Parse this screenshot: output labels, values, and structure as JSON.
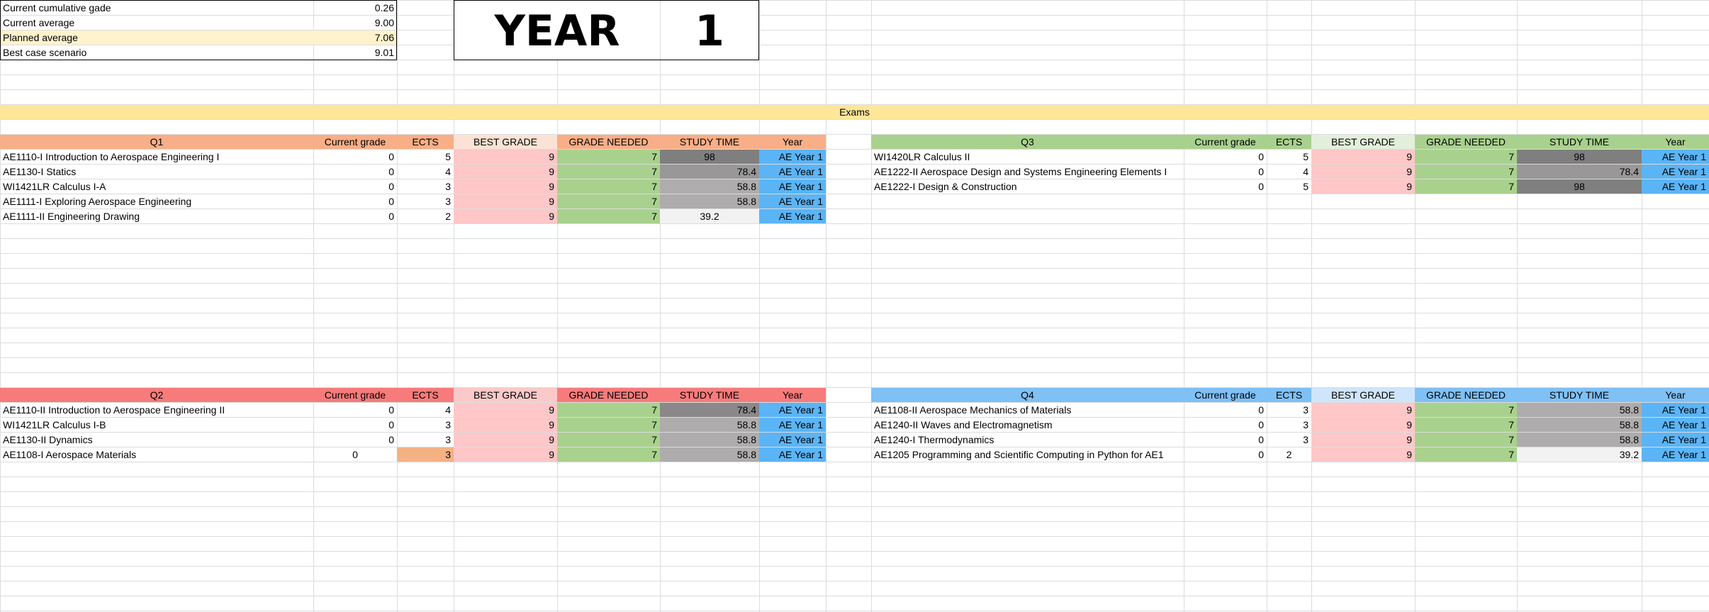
{
  "summary": [
    {
      "label": "Current cumulative gade",
      "value": "0.26",
      "highlight": false
    },
    {
      "label": "Current average",
      "value": "9.00",
      "highlight": false
    },
    {
      "label": "Planned average",
      "value": "7.06",
      "highlight": true
    },
    {
      "label": "Best case scenario",
      "value": "9.01",
      "highlight": false
    }
  ],
  "year_box": {
    "word": "YEAR",
    "number": "1"
  },
  "exams_banner": "Exams",
  "headers": {
    "current_grade": "Current grade",
    "ects": "ECTS",
    "best_grade": "BEST GRADE",
    "grade_needed": "GRADE NEEDED",
    "study_time": "STUDY TIME",
    "year": "Year"
  },
  "colors": {
    "q1": "#f8ae86",
    "q1_light": "#fce2d4",
    "q2": "#f77b7b",
    "q2_light": "#fcc9c9",
    "q3": "#a9d18e",
    "q3_light": "#e2efda",
    "q4": "#7fc0f5",
    "q4_light": "#cfe5fb",
    "best": "#ffc7c7",
    "needed": "#a9d18e",
    "year": "#5bb4f5",
    "banner": "#ffe699",
    "highlight": "#fff2cc"
  },
  "quarters": [
    {
      "id": "q1",
      "name": "Q1",
      "courses": [
        {
          "course": "AE1110-I Introduction to Aerospace Engineering I",
          "current": "0",
          "ects": "5",
          "best": "9",
          "needed": "7",
          "study": "98",
          "year": "AE Year 1",
          "study_shade": "#7f7f7f"
        },
        {
          "course": "AE1130-I Statics",
          "current": "0",
          "ects": "4",
          "best": "9",
          "needed": "7",
          "study": "78.4",
          "year": "AE Year 1",
          "study_shade": "#999797"
        },
        {
          "course": "WI1421LR Calculus I-A",
          "current": "0",
          "ects": "3",
          "best": "9",
          "needed": "7",
          "study": "58.8",
          "year": "AE Year 1",
          "study_shade": "#aeacac"
        },
        {
          "course": "AE1111-I Exploring Aerospace Engineering",
          "current": "0",
          "ects": "3",
          "best": "9",
          "needed": "7",
          "study": "58.8",
          "year": "AE Year 1",
          "study_shade": "#aeacac"
        },
        {
          "course": "AE1111-II Engineering Drawing",
          "current": "0",
          "ects": "2",
          "best": "9",
          "needed": "7",
          "study": "39.2",
          "year": "AE Year 1",
          "study_shade": "#f2f2f2"
        }
      ]
    },
    {
      "id": "q3",
      "name": "Q3",
      "courses": [
        {
          "course": "WI1420LR Calculus II",
          "current": "0",
          "ects": "5",
          "best": "9",
          "needed": "7",
          "study": "98",
          "year": "AE Year 1",
          "study_shade": "#7f7f7f"
        },
        {
          "course": "AE1222-II Aerospace Design and Systems Engineering Elements I",
          "current": "0",
          "ects": "4",
          "best": "9",
          "needed": "7",
          "study": "78.4",
          "year": "AE Year 1",
          "study_shade": "#999797"
        },
        {
          "course": "AE1222-I Design & Construction",
          "current": "0",
          "ects": "5",
          "best": "9",
          "needed": "7",
          "study": "98",
          "year": "AE Year 1",
          "study_shade": "#7f7f7f"
        }
      ]
    },
    {
      "id": "q2",
      "name": "Q2",
      "courses": [
        {
          "course": "AE1110-II Introduction to Aerospace Engineering II",
          "current": "0",
          "ects": "4",
          "best": "9",
          "needed": "7",
          "study": "78.4",
          "year": "AE Year 1",
          "study_shade": "#8a8888"
        },
        {
          "course": "WI1421LR Calculus I-B",
          "current": "0",
          "ects": "3",
          "best": "9",
          "needed": "7",
          "study": "58.8",
          "year": "AE Year 1",
          "study_shade": "#aeacac"
        },
        {
          "course": "AE1130-II Dynamics",
          "current": "0",
          "ects": "3",
          "best": "9",
          "needed": "7",
          "study": "58.8",
          "year": "AE Year 1",
          "study_shade": "#aeacac"
        },
        {
          "course": "AE1108-I Aerospace Materials",
          "current": "0",
          "ects": "3",
          "best": "9",
          "needed": "7",
          "study": "58.8",
          "year": "AE Year 1",
          "study_shade": "#aeacac",
          "current_center": true,
          "ects_shade": "#f4b183"
        }
      ]
    },
    {
      "id": "q4",
      "name": "Q4",
      "courses": [
        {
          "course": "AE1108-II Aerospace Mechanics of Materials",
          "current": "0",
          "ects": "3",
          "best": "9",
          "needed": "7",
          "study": "58.8",
          "year": "AE Year 1",
          "study_shade": "#aeacac"
        },
        {
          "course": "AE1240-II Waves and Electromagnetism",
          "current": "0",
          "ects": "3",
          "best": "9",
          "needed": "7",
          "study": "58.8",
          "year": "AE Year 1",
          "study_shade": "#aeacac"
        },
        {
          "course": "AE1240-I Thermodynamics",
          "current": "0",
          "ects": "3",
          "best": "9",
          "needed": "7",
          "study": "58.8",
          "year": "AE Year 1",
          "study_shade": "#aeacac"
        },
        {
          "course": "AE1205 Programming and Scientific Computing in Python for AE1",
          "current": "0",
          "ects": "2",
          "best": "9",
          "needed": "7",
          "study": "39.2",
          "year": "AE Year 1",
          "study_shade": "#f2f2f2",
          "ects_center": true,
          "study_right": true
        }
      ]
    }
  ]
}
